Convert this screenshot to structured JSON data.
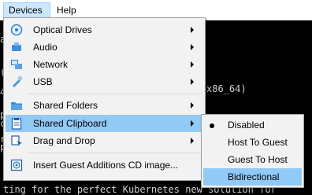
{
  "menubar": {
    "items": [
      {
        "label": "Devices"
      },
      {
        "label": "Help"
      }
    ]
  },
  "console": {
    "lines": [
      "a",
      "(",
      "4",
      "x86_64)",
      "p",
      "c",
      "r",
      "p",
      "ting for the perfect Kubernetes new solution for"
    ]
  },
  "devices_menu": {
    "items": [
      {
        "label": "Optical Drives",
        "icon": "optical-disc-icon",
        "has_submenu": true
      },
      {
        "label": "Audio",
        "icon": "audio-icon",
        "has_submenu": true
      },
      {
        "label": "Network",
        "icon": "network-icon",
        "has_submenu": true
      },
      {
        "label": "USB",
        "icon": "usb-icon",
        "has_submenu": true
      },
      {
        "label": "Shared Folders",
        "icon": "folder-icon",
        "has_submenu": true
      },
      {
        "label": "Shared Clipboard",
        "icon": "clipboard-icon",
        "has_submenu": true,
        "active": true
      },
      {
        "label": "Drag and Drop",
        "icon": "drag-drop-icon",
        "has_submenu": true
      },
      {
        "label": "Insert Guest Additions CD image...",
        "icon": "cd-image-icon",
        "has_submenu": false
      }
    ]
  },
  "clipboard_submenu": {
    "items": [
      {
        "label": "Disabled",
        "selected": true
      },
      {
        "label": "Host To Guest"
      },
      {
        "label": "Guest To Host"
      },
      {
        "label": "Bidirectional",
        "active": true
      }
    ]
  },
  "colors": {
    "menu_bg": "#f2f2f2",
    "highlight": "#91c9f7",
    "menubar_active": "#cce8ff"
  }
}
